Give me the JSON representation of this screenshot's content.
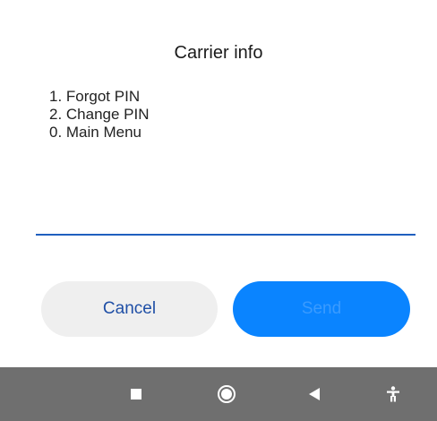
{
  "dialog": {
    "title": "Carrier info",
    "message_lines": [
      "1. Forgot PIN",
      "2. Change PIN",
      "0. Main Menu"
    ],
    "input_value": "",
    "cancel_label": "Cancel",
    "send_label": "Send"
  },
  "navbar": {
    "icons": [
      "recents-square-icon",
      "home-circle-icon",
      "back-triangle-icon",
      "accessibility-icon"
    ]
  },
  "colors": {
    "accent": "#0a84ff",
    "input_underline": "#1f5fbf",
    "cancel_text": "#1f4fa6",
    "navbar_bg": "#6f6f6f"
  }
}
